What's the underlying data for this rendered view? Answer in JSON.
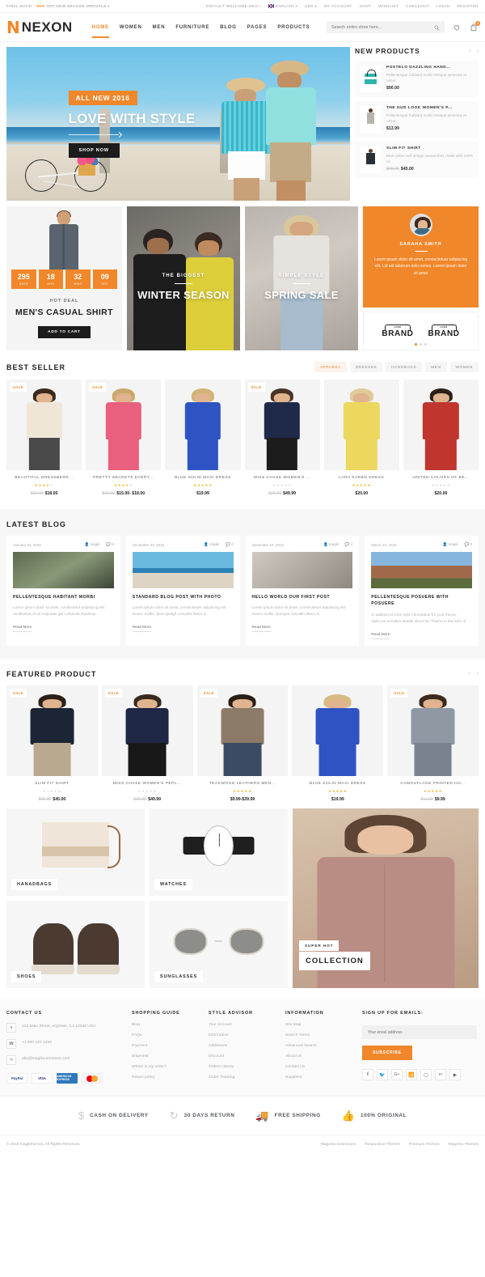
{
  "topbar": {
    "promo_prefix": "FINAL DAYS! - ",
    "promo_highlight": "50%",
    "promo_suffix": " OFF NEW SEASON ARRIVALS ",
    "welcome": "DEFAULT WELCOME MSG !",
    "language": "ENGLISH",
    "currency": "USD",
    "links": [
      "MY ACCOUNT",
      "SHOP",
      "WISHLIST",
      "CHECKOUT",
      "LOGIN",
      "REGISTER"
    ]
  },
  "header": {
    "logo_mark": "N",
    "logo_text": "NEXON",
    "nav": [
      {
        "label": "HOME",
        "active": true
      },
      {
        "label": "WOMEN",
        "active": false
      },
      {
        "label": "MEN",
        "active": false
      },
      {
        "label": "FURNITURE",
        "active": false
      },
      {
        "label": "BLOG",
        "active": false
      },
      {
        "label": "PAGES",
        "active": false
      },
      {
        "label": "PRODUCTS",
        "active": false
      }
    ],
    "search_placeholder": "Search entire store here...",
    "cart_count": "0"
  },
  "hero": {
    "tag": "ALL NEW 2016",
    "title": "LOVE WITH STYLE",
    "cta": "SHOP NOW"
  },
  "new_products": {
    "title": "NEW PRODUCTS",
    "prev": "‹",
    "next": "›",
    "items": [
      {
        "name": "POSTELO DAZZLING HAND...",
        "desc": "Pellentesque habitant morbi tristique senectus et netus",
        "price": "$90.00",
        "old_price": ""
      },
      {
        "name": "THE GUD LOOK WOMEN'S P...",
        "desc": "Pellentesque habitant morbi tristique senectus et netus",
        "price": "$13.99",
        "old_price": ""
      },
      {
        "name": "SLIM FIT SHIRT",
        "desc": "Blue colour self design casual shirt, made with 100% co",
        "price": "$45.00",
        "old_price": "$55.00"
      }
    ]
  },
  "promo": {
    "deal": {
      "countdown": [
        {
          "num": "295",
          "label": "DAYS"
        },
        {
          "num": "18",
          "label": "HRS"
        },
        {
          "num": "32",
          "label": "MINS"
        },
        {
          "num": "09",
          "label": "SEC"
        }
      ],
      "subtitle": "HOT DEAL",
      "name": "MEN'S CASUAL SHIRT",
      "button": "ADD TO CART"
    },
    "winter": {
      "sub": "THE BIGGEST",
      "title": "WINTER SEASON"
    },
    "spring": {
      "sub": "SIMPLE STYLE",
      "title": "SPRING SALE"
    },
    "testimonial": {
      "name": "SARAHA SMITH",
      "text": "Lorem ipsum dolor sit amet, consectetuer adipiscing elit. Lid est laborum dolo rumes. Lorem ipsum dolor sit amet"
    },
    "brands": [
      {
        "small": "LOGO",
        "name": "BRAND"
      },
      {
        "small": "LOGO",
        "name": "BRAND"
      }
    ]
  },
  "best_seller": {
    "title": "BEST SELLER",
    "tabs": [
      {
        "label": "APPAREL",
        "active": true
      },
      {
        "label": "DRESSES",
        "active": false
      },
      {
        "label": "HANDBAGS",
        "active": false
      },
      {
        "label": "MEN",
        "active": false
      },
      {
        "label": "WOMEN",
        "active": false
      }
    ],
    "products": [
      {
        "name": "BEAUTIFUL DRESSBERR...",
        "sale": true,
        "badge": "SALE",
        "rating": 4,
        "price": "$18.00",
        "old_price": "$20.00",
        "hair": "#3a2a1e",
        "top": "#f0e6d8",
        "lower": "#4a4a4a"
      },
      {
        "name": "PRETTY SECRETS EVERY...",
        "sale": true,
        "badge": "SALE",
        "rating": 4,
        "price": "$15.00- $18.00",
        "old_price": "$20.00",
        "hair": "#c9a86b",
        "top": "#e8607d",
        "lower": "#e8607d"
      },
      {
        "name": "BLUE SOLID MAXI DRESS",
        "sale": false,
        "badge": "",
        "rating": 5,
        "price": "$19.99",
        "old_price": "",
        "hair": "#d3b378",
        "top": "#2e54c4",
        "lower": "#2e54c4"
      },
      {
        "name": "MISS CHASE WOMEN'S ...",
        "sale": true,
        "badge": "SALE",
        "rating": 0,
        "price": "$49.99",
        "old_price": "$69.99",
        "hair": "#4a3425",
        "top": "#1f2a4a",
        "lower": "#1c1c1c"
      },
      {
        "name": "LARA KAREN DRESS",
        "sale": false,
        "badge": "",
        "rating": 5,
        "price": "$20.00",
        "old_price": "",
        "hair": "#e0cc9a",
        "top": "#ecd85e",
        "lower": "#ecd85e"
      },
      {
        "name": "UNITED COLORS OF BE...",
        "sale": false,
        "badge": "",
        "rating": 0,
        "price": "$20.00",
        "old_price": "",
        "hair": "#2b1f18",
        "top": "#c0352e",
        "lower": "#c0352e"
      }
    ]
  },
  "blog": {
    "title": "LATEST BLOG",
    "posts": [
      {
        "date": "January 04, 2016",
        "author": "magik",
        "comments": "5",
        "title": "PELLENTESQUE HABITANT MORBI",
        "excerpt": "Lorem ipsum dolor sit amet, consectetur adipiscing elit. Vestibulum et mi vulputate gen vehicula maximus.",
        "read_more": "Read More"
      },
      {
        "date": "December 02, 2015",
        "author": "magik",
        "comments": "4",
        "title": "STANDARD BLOG POST WITH PHOTO",
        "excerpt": "Lorem ipsum dolor sit amet, consectetuer adipiscing elit. Donec mollis. Quis quafgh convallis libero in",
        "read_more": "Read More"
      },
      {
        "date": "November 10, 2015",
        "author": "magik",
        "comments": "4",
        "title": "HELLO WORLD OUR FIRST POST",
        "excerpt": "Lorem ipsum dolor sit amet, consectetuer adipiscing elit. Donec mollis. Quisque convallis libero in",
        "read_more": "Read More"
      },
      {
        "date": "March 24, 2015",
        "author": "magik",
        "comments": "0",
        "title": "PELLENTESQUE POSUERE WITH POSUERE",
        "excerpt": "In addition to CSS style information for your theme, style.css provides details about the Theme in the form of",
        "read_more": "Read More"
      }
    ]
  },
  "featured": {
    "title": "FEATURED PRODUCT",
    "prev": "‹",
    "next": "›",
    "products": [
      {
        "name": "SLIM FIT SHIRT",
        "sale": true,
        "badge": "SALE",
        "rating": 0,
        "price": "$45.00",
        "old_price": "$55.00",
        "hair": "#2c1f17",
        "top": "#1c2535",
        "lower": "#b9a98e"
      },
      {
        "name": "MISS CHASE WOMEN'S PEPL...",
        "sale": true,
        "badge": "SALE",
        "rating": 0,
        "price": "$49.99",
        "old_price": "$65.99",
        "hair": "#3a2a1e",
        "top": "#1e2744",
        "lower": "#181818"
      },
      {
        "name": "TEAKWOOD LEATHERS MEN...",
        "sale": true,
        "badge": "SALE",
        "rating": 5,
        "price": "$9.99-$39.99",
        "old_price": "",
        "hair": "#2a1d14",
        "top": "#8c7b68",
        "lower": "#3d4a63"
      },
      {
        "name": "BLUE SOLID MAXI DRESS",
        "sale": false,
        "badge": "",
        "rating": 5,
        "price": "$19.99",
        "old_price": "",
        "hair": "#d7bb83",
        "top": "#2e54c4",
        "lower": "#2e54c4"
      },
      {
        "name": "CAMOUFLAGE PRINTED HO...",
        "sale": true,
        "badge": "SALE",
        "rating": 5,
        "price": "$9.99",
        "old_price": "$11.99",
        "hair": "#3b2a1d",
        "top": "#8f98a3",
        "lower": "#7a8290"
      }
    ]
  },
  "categories": [
    {
      "label": "HANADBAGS"
    },
    {
      "label": "WATCHES"
    },
    {
      "label": "SHOES"
    },
    {
      "label": "SUNGLASSES"
    }
  ],
  "collection": {
    "sub": "SUPER HOT",
    "title": "COLLECTION"
  },
  "footer": {
    "contact": {
      "title": "CONTACT US",
      "address": "123 Main Street, Anytown, CA 12345 USA",
      "phone": "+1 800 123 1234",
      "email": "abc@magikcommerce.com",
      "cards": [
        "PayPal",
        "VISA",
        "AMERICAN EXPRESS",
        ""
      ]
    },
    "shopping_guide": {
      "title": "SHOPPING GUIDE",
      "links": [
        "Blog",
        "FAQs",
        "Payment",
        "Shipment",
        "Where is my order?",
        "Return policy"
      ]
    },
    "style_advisor": {
      "title": "STYLE ADVISOR",
      "links": [
        "Your Account",
        "Information",
        "Addresses",
        "Discount",
        "Orders History",
        "Order Tracking"
      ]
    },
    "information": {
      "title": "INFORMATION",
      "links": [
        "Site Map",
        "Search Terms",
        "Advanced Search",
        "About Us",
        "Contact Us",
        "Suppliers"
      ]
    },
    "newsletter": {
      "title": "SIGN UP FOR EMAILS:",
      "placeholder": "Your email address",
      "button": "SUBSCRIBE",
      "socials": [
        "f",
        "t",
        "G+",
        "rss",
        "ig",
        "in",
        "yt"
      ]
    }
  },
  "services": [
    {
      "icon": "$",
      "label": "CASH ON DELIVERY"
    },
    {
      "icon": "↻",
      "label": "30 DAYS RETURN"
    },
    {
      "icon": "truck",
      "label": "FREE SHIPPING"
    },
    {
      "icon": "thumb",
      "label": "100% ORIGINAL"
    }
  ],
  "copyright": {
    "text": "© 2016 magikthemes, All Rights Reserved.",
    "links": [
      "Magento Extensions",
      "Responsive Themes",
      "Premium Themes",
      "Magento Themes"
    ]
  }
}
